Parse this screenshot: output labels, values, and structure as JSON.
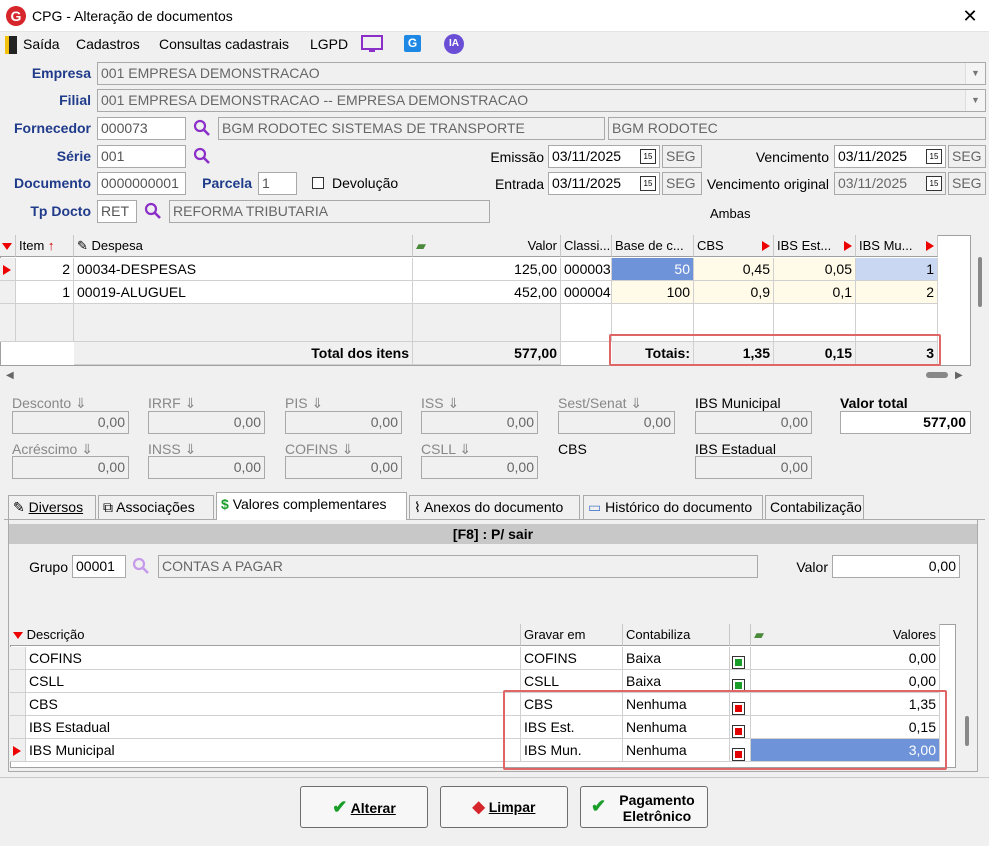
{
  "window": {
    "title": "CPG - Alteração de documentos",
    "close": "✕"
  },
  "menu": {
    "items": [
      "Saída",
      "Cadastros",
      "Consultas cadastrais",
      "LGPD"
    ],
    "ia": "IA",
    "g": "G"
  },
  "form": {
    "empresa": {
      "label": "Empresa",
      "value": "001 EMPRESA DEMONSTRACAO"
    },
    "filial": {
      "label": "Filial",
      "value": "001 EMPRESA DEMONSTRACAO -- EMPRESA DEMONSTRACAO"
    },
    "fornecedor": {
      "label": "Fornecedor",
      "code": "000073",
      "name": "BGM RODOTEC SISTEMAS DE TRANSPORTE",
      "short": "BGM RODOTEC"
    },
    "serie": {
      "label": "Série",
      "value": "001"
    },
    "documento": {
      "label": "Documento",
      "value": "0000000001"
    },
    "parcela": {
      "label": "Parcela",
      "value": "1"
    },
    "devolucao": {
      "label": "Devolução"
    },
    "tpdocto": {
      "label": "Tp Docto",
      "code": "RET",
      "name": "REFORMA TRIBUTARIA"
    },
    "emissao": {
      "label": "Emissão",
      "date": "03/11/2025",
      "day": "SEG"
    },
    "entrada": {
      "label": "Entrada",
      "date": "03/11/2025",
      "day": "SEG"
    },
    "vencimento": {
      "label": "Vencimento",
      "date": "03/11/2025",
      "day": "SEG"
    },
    "venc_original": {
      "label": "Vencimento original",
      "date": "03/11/2025",
      "day": "SEG"
    },
    "ambas": "Ambas",
    "cal_icon": "15"
  },
  "items_grid": {
    "headers": {
      "item": "Item",
      "despesa": "Despesa",
      "valor": "Valor",
      "classi": "Classi...",
      "base": "Base de c...",
      "cbs": "CBS",
      "ibsest": "IBS Est...",
      "ibsmun": "IBS Mu..."
    },
    "rows": [
      {
        "item": "2",
        "despesa": "00034-DESPESAS",
        "valor": "125,00",
        "classi": "000003",
        "base": "50",
        "cbs": "0,45",
        "ibsest": "0,05",
        "ibsmun": "1"
      },
      {
        "item": "1",
        "despesa": "00019-ALUGUEL",
        "valor": "452,00",
        "classi": "000004",
        "base": "100",
        "cbs": "0,9",
        "ibsest": "0,1",
        "ibsmun": "2"
      }
    ],
    "total_label": "Total dos itens",
    "total_value": "577,00",
    "totais_label": "Totais:",
    "tot_cbs": "1,35",
    "tot_ibsest": "0,15",
    "tot_ibsmun": "3"
  },
  "taxes": {
    "desconto": {
      "label": "Desconto",
      "value": "0,00"
    },
    "irrf": {
      "label": "IRRF",
      "value": "0,00"
    },
    "pis": {
      "label": "PIS",
      "value": "0,00"
    },
    "iss": {
      "label": "ISS",
      "value": "0,00"
    },
    "sestsenat": {
      "label": "Sest/Senat",
      "value": "0,00"
    },
    "ibsmunicipal": {
      "label": "IBS Municipal",
      "value": "0,00"
    },
    "valortotal": {
      "label": "Valor total",
      "value": "577,00"
    },
    "acrescimo": {
      "label": "Acréscimo",
      "value": "0,00"
    },
    "inss": {
      "label": "INSS",
      "value": "0,00"
    },
    "cofins": {
      "label": "COFINS",
      "value": "0,00"
    },
    "csll": {
      "label": "CSLL",
      "value": "0,00"
    },
    "cbs": {
      "label": "CBS",
      "value": ""
    },
    "ibsestadual": {
      "label": "IBS Estadual",
      "value": "0,00"
    }
  },
  "tabs": [
    "Diversos",
    "Associações",
    "Valores complementares",
    "Anexos do documento",
    "Histórico do documento",
    "Contabilização"
  ],
  "panel": {
    "header": "[F8] : P/ sair",
    "grupo_label": "Grupo",
    "grupo_code": "00001",
    "grupo_name": "CONTAS A PAGAR",
    "valor_label": "Valor",
    "valor_value": "0,00"
  },
  "comp_grid": {
    "headers": {
      "descricao": "Descrição",
      "gravar": "Gravar em",
      "contabiliza": "Contabiliza",
      "valores": "Valores"
    },
    "rows": [
      {
        "descricao": "COFINS",
        "gravar": "COFINS",
        "contabiliza": "Baixa",
        "valor": "0,00",
        "color": "#1a9e2a"
      },
      {
        "descricao": "CSLL",
        "gravar": "CSLL",
        "contabiliza": "Baixa",
        "valor": "0,00",
        "color": "#1a9e2a"
      },
      {
        "descricao": "CBS",
        "gravar": "CBS",
        "contabiliza": "Nenhuma",
        "valor": "1,35",
        "color": "#e00000"
      },
      {
        "descricao": "IBS Estadual",
        "gravar": "IBS Est.",
        "contabiliza": "Nenhuma",
        "valor": "0,15",
        "color": "#e00000"
      },
      {
        "descricao": "IBS Municipal",
        "gravar": "IBS Mun.",
        "contabiliza": "Nenhuma",
        "valor": "3,00",
        "color": "#e00000"
      }
    ]
  },
  "buttons": {
    "alterar": "Alterar",
    "limpar": "Limpar",
    "pagamento1": "Pagamento",
    "pagamento2": "Eletrônico"
  },
  "colors": {
    "accent": "#1f3b8a",
    "selection": "#6f93d9",
    "highlight": "#e06666"
  }
}
